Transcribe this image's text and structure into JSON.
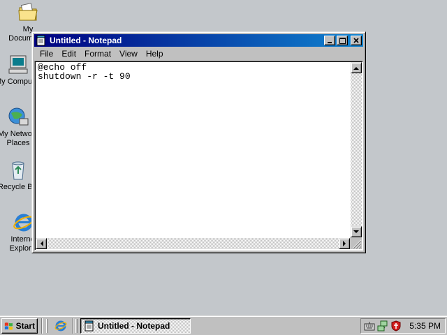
{
  "desktop": {
    "icons": [
      {
        "label": "My Documents",
        "icon": "folder-documents-icon"
      },
      {
        "label": "My Computer",
        "icon": "computer-icon"
      },
      {
        "label": "My Network\nPlaces",
        "icon": "network-icon"
      },
      {
        "label": "Recycle Bin",
        "icon": "recycle-bin-icon"
      },
      {
        "label": "Internet\nExplorer",
        "icon": "internet-explorer-icon"
      }
    ]
  },
  "window": {
    "title": "Untitled - Notepad",
    "buttons": {
      "minimize": "_",
      "maximize": "□",
      "close": "×"
    },
    "menu": [
      "File",
      "Edit",
      "Format",
      "View",
      "Help"
    ],
    "content": "@echo off\nshutdown -r -t 90"
  },
  "taskbar": {
    "start_label": "Start",
    "task_label": "Untitled - Notepad",
    "clock": "5:35 PM"
  },
  "colors": {
    "desktop": "#c3c7cb",
    "titlebar_start": "#000080",
    "titlebar_end": "#1084d0",
    "face": "#c0c0c0"
  }
}
